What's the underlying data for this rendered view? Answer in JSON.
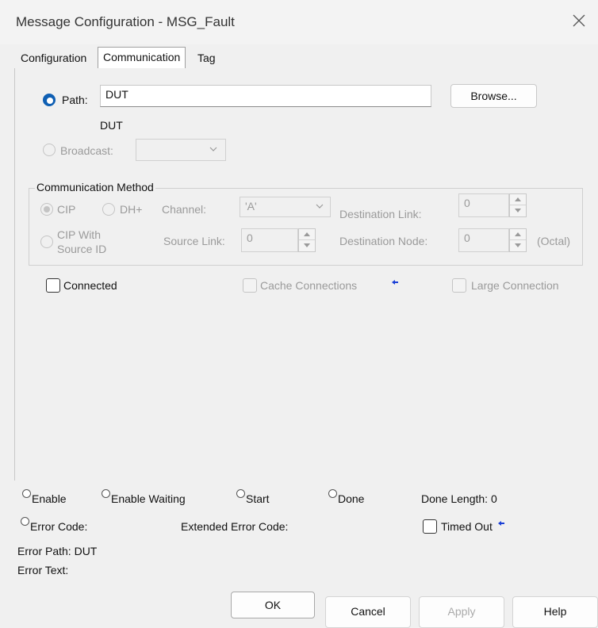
{
  "window": {
    "title": "Message Configuration - MSG_Fault"
  },
  "tabs": [
    "Configuration",
    "Communication",
    "Tag"
  ],
  "path": {
    "label": "Path:",
    "value": "DUT",
    "resolved": "DUT",
    "browse_label": "Browse..."
  },
  "broadcast": {
    "label": "Broadcast:",
    "value": ""
  },
  "comm_method": {
    "title": "Communication Method",
    "cip_label": "CIP",
    "dh_label": "DH+",
    "cip_source_label_1": "CIP With",
    "cip_source_label_2": "Source ID",
    "channel_label": "Channel:",
    "channel_value": "'A'",
    "dest_link_label": "Destination Link:",
    "dest_link_value": "0",
    "source_link_label": "Source Link:",
    "source_link_value": "0",
    "dest_node_label": "Destination Node:",
    "dest_node_value": "0",
    "octal_label": "(Octal)"
  },
  "options": {
    "connected_label": "Connected",
    "cache_label": "Cache Connections",
    "large_label": "Large Connection"
  },
  "status": {
    "enable": "Enable",
    "enable_waiting": "Enable Waiting",
    "start": "Start",
    "done": "Done",
    "done_length_label": "Done Length: 0",
    "error_code": "Error Code:",
    "extended_error_code": "Extended Error Code:",
    "timed_out": "Timed Out",
    "error_path": "Error Path: DUT",
    "error_text": "Error Text:"
  },
  "buttons": {
    "ok": "OK",
    "cancel": "Cancel",
    "apply": "Apply",
    "help": "Help"
  },
  "colors": {
    "accent": "#0f5fb3",
    "arrow": "#1a3fd6"
  }
}
